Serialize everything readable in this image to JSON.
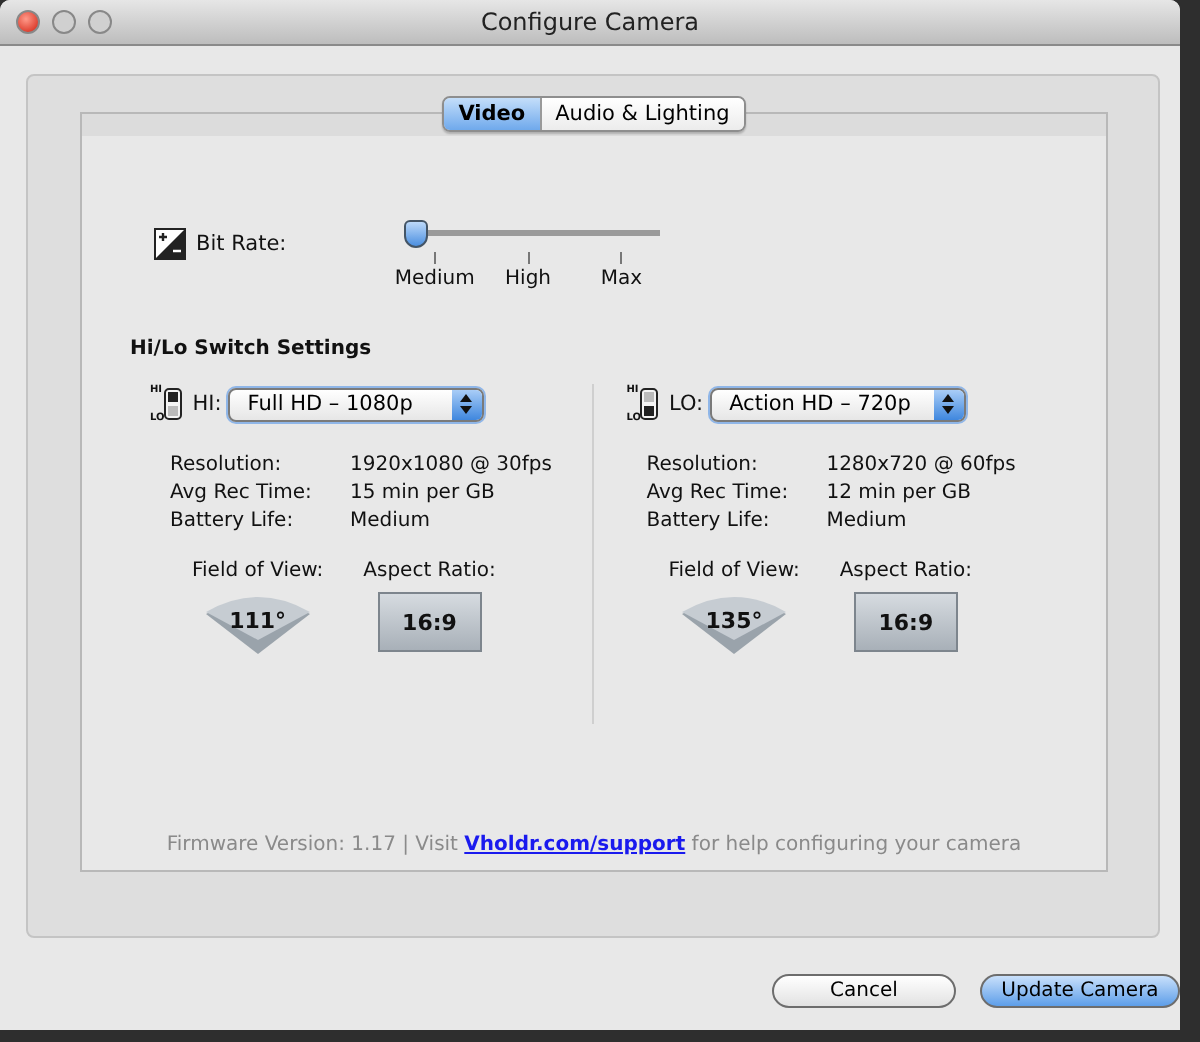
{
  "window": {
    "title": "Configure Camera"
  },
  "tabs": [
    {
      "label": "Video",
      "selected": true
    },
    {
      "label": "Audio & Lighting",
      "selected": false
    }
  ],
  "bit_rate": {
    "label": "Bit Rate:",
    "level": 0,
    "ticks": [
      "Medium",
      "High",
      "Max"
    ]
  },
  "section_title": "Hi/Lo Switch Settings",
  "profiles": [
    {
      "hi_mark": "HI",
      "lo_mark": "LO",
      "lever_up": true,
      "switch_label": "HI:",
      "mode": "Full HD – 1080p",
      "specs": [
        {
          "label": "Resolution:",
          "value": "1920x1080 @ 30fps"
        },
        {
          "label": "Avg Rec Time:",
          "value": "15 min per GB"
        },
        {
          "label": "Battery Life:",
          "value": "Medium"
        }
      ],
      "fov_label": "Field of View:",
      "fov": "111°",
      "aspect_label": "Aspect Ratio:",
      "aspect": "16:9"
    },
    {
      "hi_mark": "HI",
      "lo_mark": "LO",
      "lever_up": false,
      "switch_label": "LO:",
      "mode": "Action HD – 720p",
      "specs": [
        {
          "label": "Resolution:",
          "value": "1280x720 @ 60fps"
        },
        {
          "label": "Avg Rec Time:",
          "value": "12 min per GB"
        },
        {
          "label": "Battery Life:",
          "value": "Medium"
        }
      ],
      "fov_label": "Field of View:",
      "fov": "135°",
      "aspect_label": "Aspect Ratio:",
      "aspect": "16:9"
    }
  ],
  "footer": {
    "prefix": "Firmware Version: 1.17 | Visit ",
    "link": "Vholdr.com/support",
    "suffix": " for help configuring your camera"
  },
  "buttons": [
    {
      "label": "Cancel",
      "default": false
    },
    {
      "label": "Update Camera",
      "default": true
    }
  ]
}
